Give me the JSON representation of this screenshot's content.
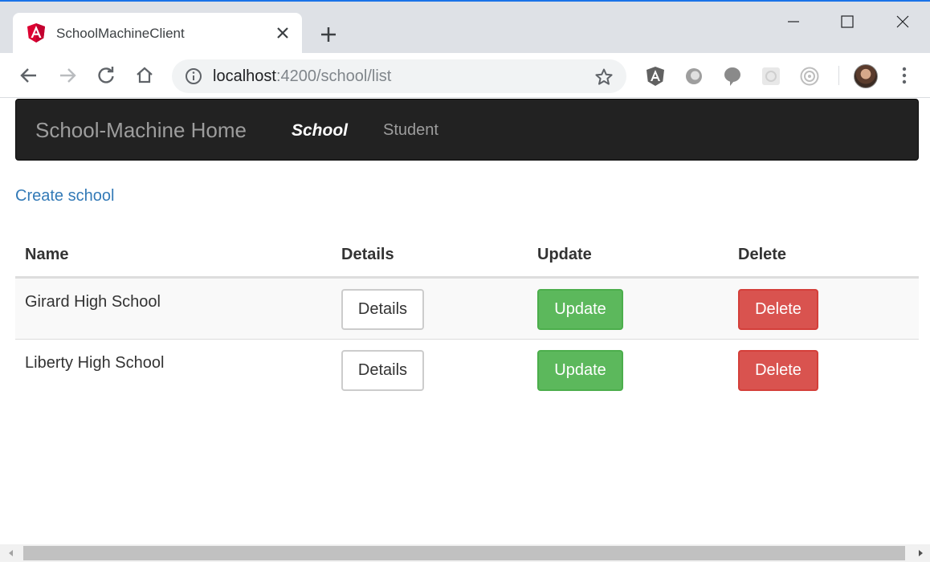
{
  "browser": {
    "tab_title": "SchoolMachineClient",
    "url_host": "localhost",
    "url_path": ":4200/school/list",
    "icons": {
      "favicon": "angular-logo-icon",
      "close_tab": "close-icon",
      "new_tab": "plus-icon",
      "back": "arrow-left-icon",
      "forward": "arrow-right-icon",
      "reload": "reload-icon",
      "home": "home-icon",
      "site_info": "info-icon",
      "bookmark": "star-icon",
      "menu": "vertical-dots-icon"
    },
    "extensions": [
      "angular-devtools-icon",
      "extension-icon",
      "speech-bubble-icon",
      "extension-icon",
      "target-icon"
    ]
  },
  "navbar": {
    "brand": "School-Machine Home",
    "links": [
      {
        "label": "School",
        "active": true
      },
      {
        "label": "Student",
        "active": false
      }
    ]
  },
  "main": {
    "create_link": "Create school",
    "table": {
      "headers": [
        "Name",
        "Details",
        "Update",
        "Delete"
      ],
      "rows": [
        {
          "name": "Girard High School",
          "details": "Details",
          "update": "Update",
          "delete": "Delete"
        },
        {
          "name": "Liberty High School",
          "details": "Details",
          "update": "Update",
          "delete": "Delete"
        }
      ]
    }
  },
  "colors": {
    "navbar_bg": "#222222",
    "link": "#337ab7",
    "success": "#5cb85c",
    "danger": "#d9534f"
  }
}
